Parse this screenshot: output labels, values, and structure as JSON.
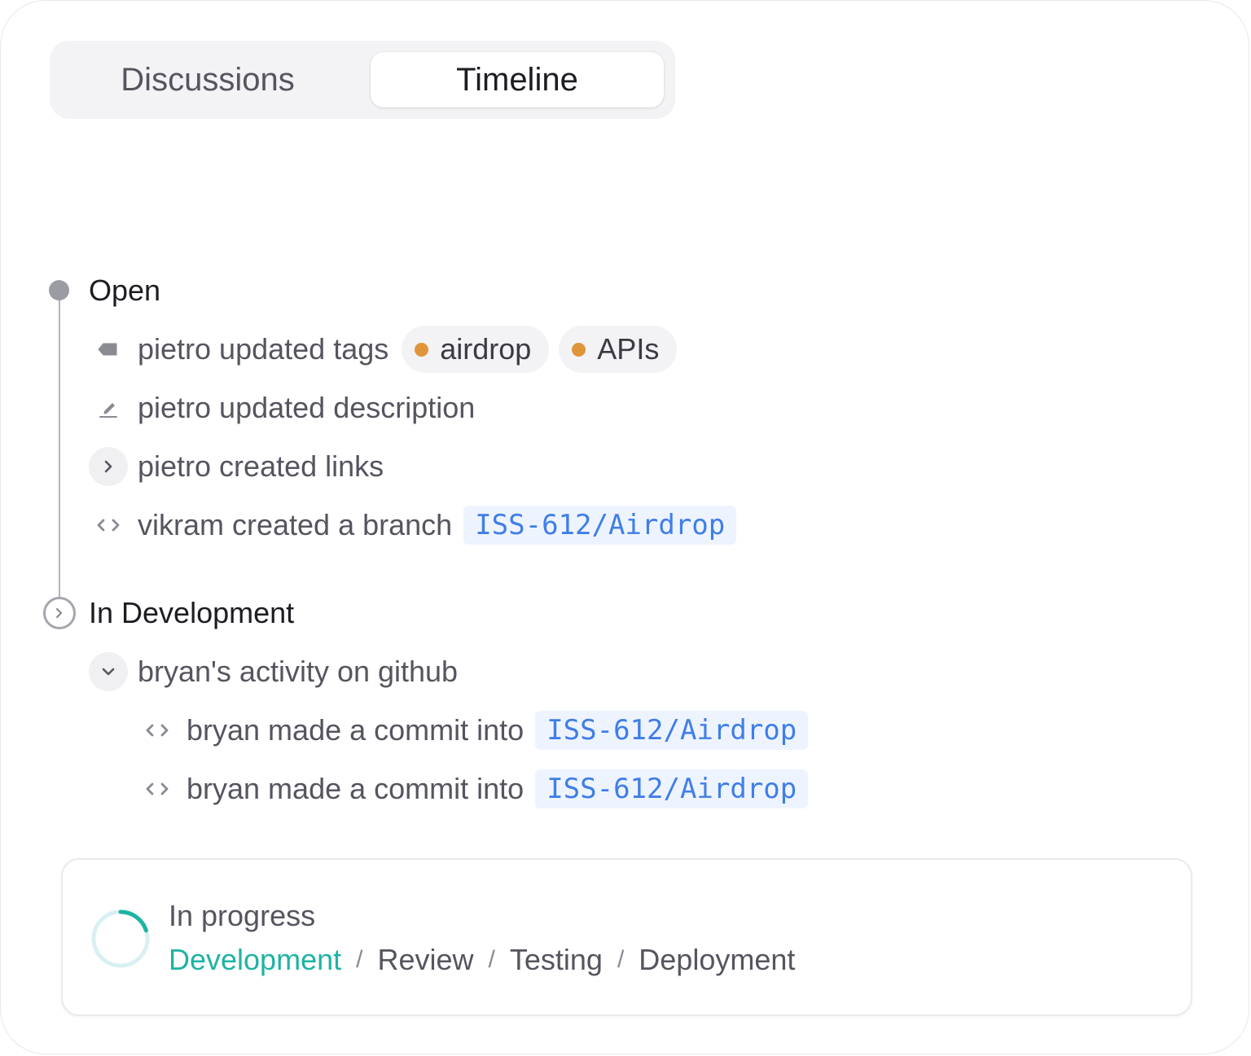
{
  "tabs": [
    {
      "label": "Discussions",
      "active": false
    },
    {
      "label": "Timeline",
      "active": true
    }
  ],
  "timeline": {
    "sections": [
      {
        "title": "Open",
        "events": [
          {
            "text": "pietro updated tags",
            "icon": "tag-icon",
            "tags": [
              {
                "label": "airdrop",
                "color": "#e0953a"
              },
              {
                "label": "APIs",
                "color": "#e0953a"
              }
            ]
          },
          {
            "text": "pietro updated description",
            "icon": "pencil-icon"
          },
          {
            "text": "pietro created links",
            "icon": "chevron-right-icon"
          },
          {
            "text": "vikram created a branch",
            "icon": "code-icon",
            "branch": "ISS-612/Airdrop"
          }
        ]
      },
      {
        "title": "In Development",
        "group": {
          "text": "bryan's activity on github",
          "icon": "chevron-down-icon",
          "events": [
            {
              "text": "bryan made a commit into",
              "icon": "code-icon",
              "branch": "ISS-612/Airdrop"
            },
            {
              "text": "bryan made a commit into",
              "icon": "code-icon",
              "branch": "ISS-612/Airdrop"
            }
          ]
        }
      }
    ]
  },
  "progress": {
    "title": "In progress",
    "fraction": 0.2,
    "stages": [
      "Development",
      "Review",
      "Testing",
      "Deployment"
    ],
    "active_stage": "Development",
    "separator": "/",
    "accent_color": "#1fb3a4"
  }
}
